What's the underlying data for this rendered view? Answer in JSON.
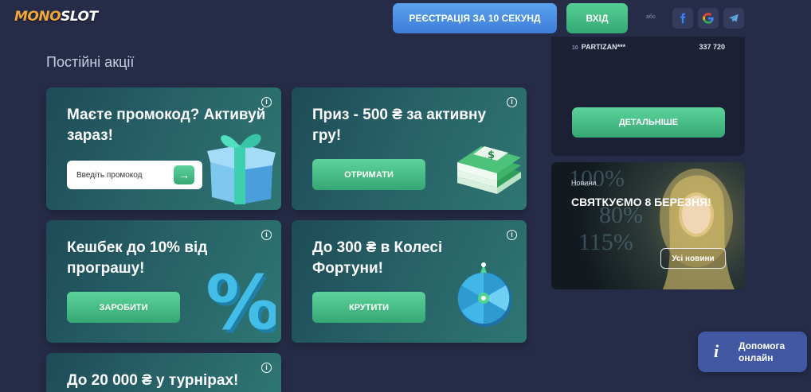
{
  "header": {
    "logo_prefix": "MONO",
    "logo_suffix": "SLOT",
    "register_label": "РЕЄСТРАЦІЯ ЗА 10 СЕКУНД",
    "login_label": "ВХІД",
    "or_text": "або",
    "social": [
      {
        "name": "facebook-icon",
        "color": "#3b82f6"
      },
      {
        "name": "google-icon",
        "color": "#ea4335"
      },
      {
        "name": "telegram-icon",
        "color": "#5fa8de"
      }
    ]
  },
  "main": {
    "section_title": "Постійні акції",
    "promos": [
      {
        "title": "Маєте промокод? Активуй зараз!",
        "input_placeholder": "Введіть промокод",
        "submit_icon": "arrow-right-icon"
      },
      {
        "title": "Приз - 500 ₴ за активну гру!",
        "button_label": "ОТРИМАТИ"
      },
      {
        "title": "Кешбек до 10% від програшу!",
        "button_label": "ЗАРОБИТИ"
      },
      {
        "title": "До 300 ₴ в Колесі Фортуни!",
        "button_label": "КРУТИТИ"
      },
      {
        "title": "До 20 000 ₴ у турнірах!"
      }
    ]
  },
  "sidebar": {
    "leaderboard": {
      "row": {
        "rank": "10",
        "name": "PARTIZAN***",
        "score": "337 720"
      },
      "details_label": "ДЕТАЛЬНІШЕ"
    },
    "news": {
      "label": "Новини",
      "title": "СВЯТКУЄМО 8 БЕРЕЗНЯ!",
      "button_label": "Усі новини"
    }
  },
  "help": {
    "icon": "i",
    "label": "Допомога онлайн"
  },
  "colors": {
    "background": "#262c47",
    "accent_green": "#45bd85",
    "accent_blue": "#4a8ee4",
    "card_teal": "#276066"
  }
}
